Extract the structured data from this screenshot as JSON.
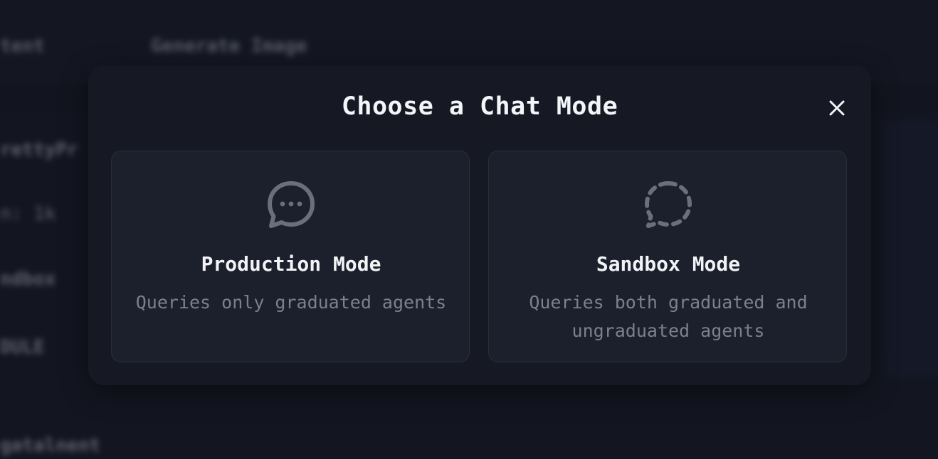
{
  "background": {
    "top_left_label": "tent",
    "top_right_label": "Generate Image",
    "sidebar_items": [
      "rettyPr",
      "n: 1k",
      "ndbox",
      "DULE"
    ],
    "bottom_label": "gatalnent"
  },
  "modal": {
    "title": "Choose a Chat Mode",
    "close_icon": "close-icon",
    "cards": [
      {
        "icon": "chat-bubble-dots-icon",
        "title": "Production Mode",
        "description": "Queries only graduated agents"
      },
      {
        "icon": "chat-bubble-dashed-icon",
        "title": "Sandbox Mode",
        "description": "Queries both graduated and ungraduated agents"
      }
    ]
  },
  "colors": {
    "page_bg": "#1a1d29",
    "modal_bg": "#161924",
    "card_bg": "#1c1f2c",
    "card_border": "#2a2e3b",
    "title_text": "#f4f5f8",
    "muted_text": "#7d808c",
    "icon_color": "#6b6e7c"
  }
}
